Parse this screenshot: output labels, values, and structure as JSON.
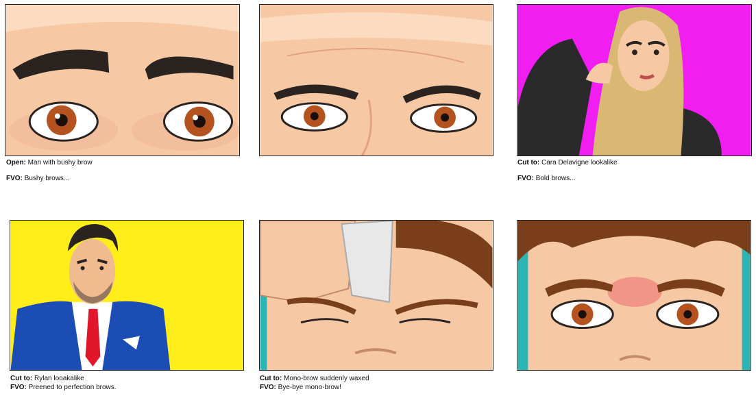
{
  "panels": [
    {
      "lines": [
        {
          "label": "Open:",
          "text": "Man with bushy brow"
        },
        {
          "label": "FVO:",
          "text": "Bushy brows..."
        }
      ]
    },
    {
      "lines": []
    },
    {
      "lines": [
        {
          "label": "Cut to:",
          "text": "Cara Delavigne lookalike"
        },
        {
          "label": "FVO:",
          "text": "Bold brows..."
        }
      ]
    },
    {
      "lines": [
        {
          "label": "Cut to:",
          "text": "Rylan looakalike"
        },
        {
          "label": "FVO:",
          "text": "Preened to perfection brows."
        }
      ]
    },
    {
      "lines": [
        {
          "label": "Cut to:",
          "text": "Mono-brow suddenly waxed"
        },
        {
          "label": "FVO:",
          "text": "Bye-bye mono-brow!"
        }
      ]
    },
    {
      "lines": []
    }
  ],
  "colors": {
    "skin": "#f6c9a4",
    "skin_shade": "#e9a787",
    "brow": "#2a2320",
    "iris": "#b4531f",
    "magenta": "#f01ef0",
    "yellow": "#ffee1a",
    "teal": "#2cb5b3",
    "suit": "#1b4db4",
    "tie": "#e2162b",
    "hair_blonde": "#d9b874",
    "hair_brown": "#7a3f1a"
  }
}
